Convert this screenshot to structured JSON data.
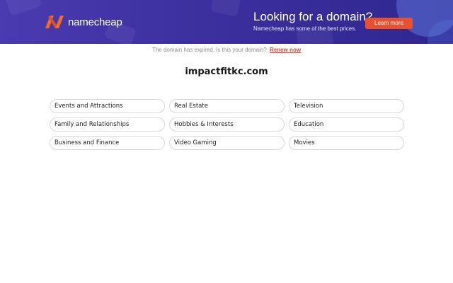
{
  "banner": {
    "brand_name": "namecheap",
    "promo_title": "Looking for a domain?",
    "promo_subtitle": "Namecheap has some of the best prices.",
    "cta_label": "Learn more",
    "colors": {
      "background": "#3c2f9e",
      "accent": "#e8502f",
      "logo": "#f26b2a"
    },
    "icon": "namecheap-logo-icon"
  },
  "notice": {
    "text": "The domain has expired. Is this your domain?",
    "link_label": "Renew now"
  },
  "domain_name": "impactfitkc.com",
  "categories": [
    {
      "label": "Events and Attractions"
    },
    {
      "label": "Real Estate"
    },
    {
      "label": "Television"
    },
    {
      "label": "Family and Relationships"
    },
    {
      "label": "Hobbies & Interests"
    },
    {
      "label": "Education"
    },
    {
      "label": "Business and Finance"
    },
    {
      "label": "Video Gaming"
    },
    {
      "label": "Movies"
    }
  ]
}
